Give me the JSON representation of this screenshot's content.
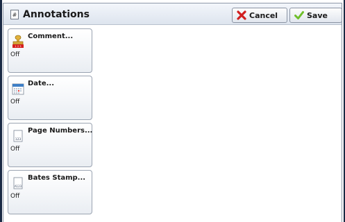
{
  "header": {
    "title": "Annotations",
    "cancel_label": "Cancel",
    "save_label": "Save"
  },
  "features": [
    {
      "label": "Comment...",
      "value": "Off",
      "icon": "stamp-icon"
    },
    {
      "label": "Date...",
      "value": "Off",
      "icon": "calendar-icon"
    },
    {
      "label": "Page Numbers...",
      "value": "Off",
      "icon": "page-number-icon",
      "icon_text": "123"
    },
    {
      "label": "Bates Stamp...",
      "value": "Off",
      "icon": "bates-stamp-icon",
      "icon_text": "A123"
    }
  ],
  "colors": {
    "cancel_x": "#d11f1f",
    "save_check": "#6fbf2a",
    "frame_dark": "#1a2a44"
  }
}
